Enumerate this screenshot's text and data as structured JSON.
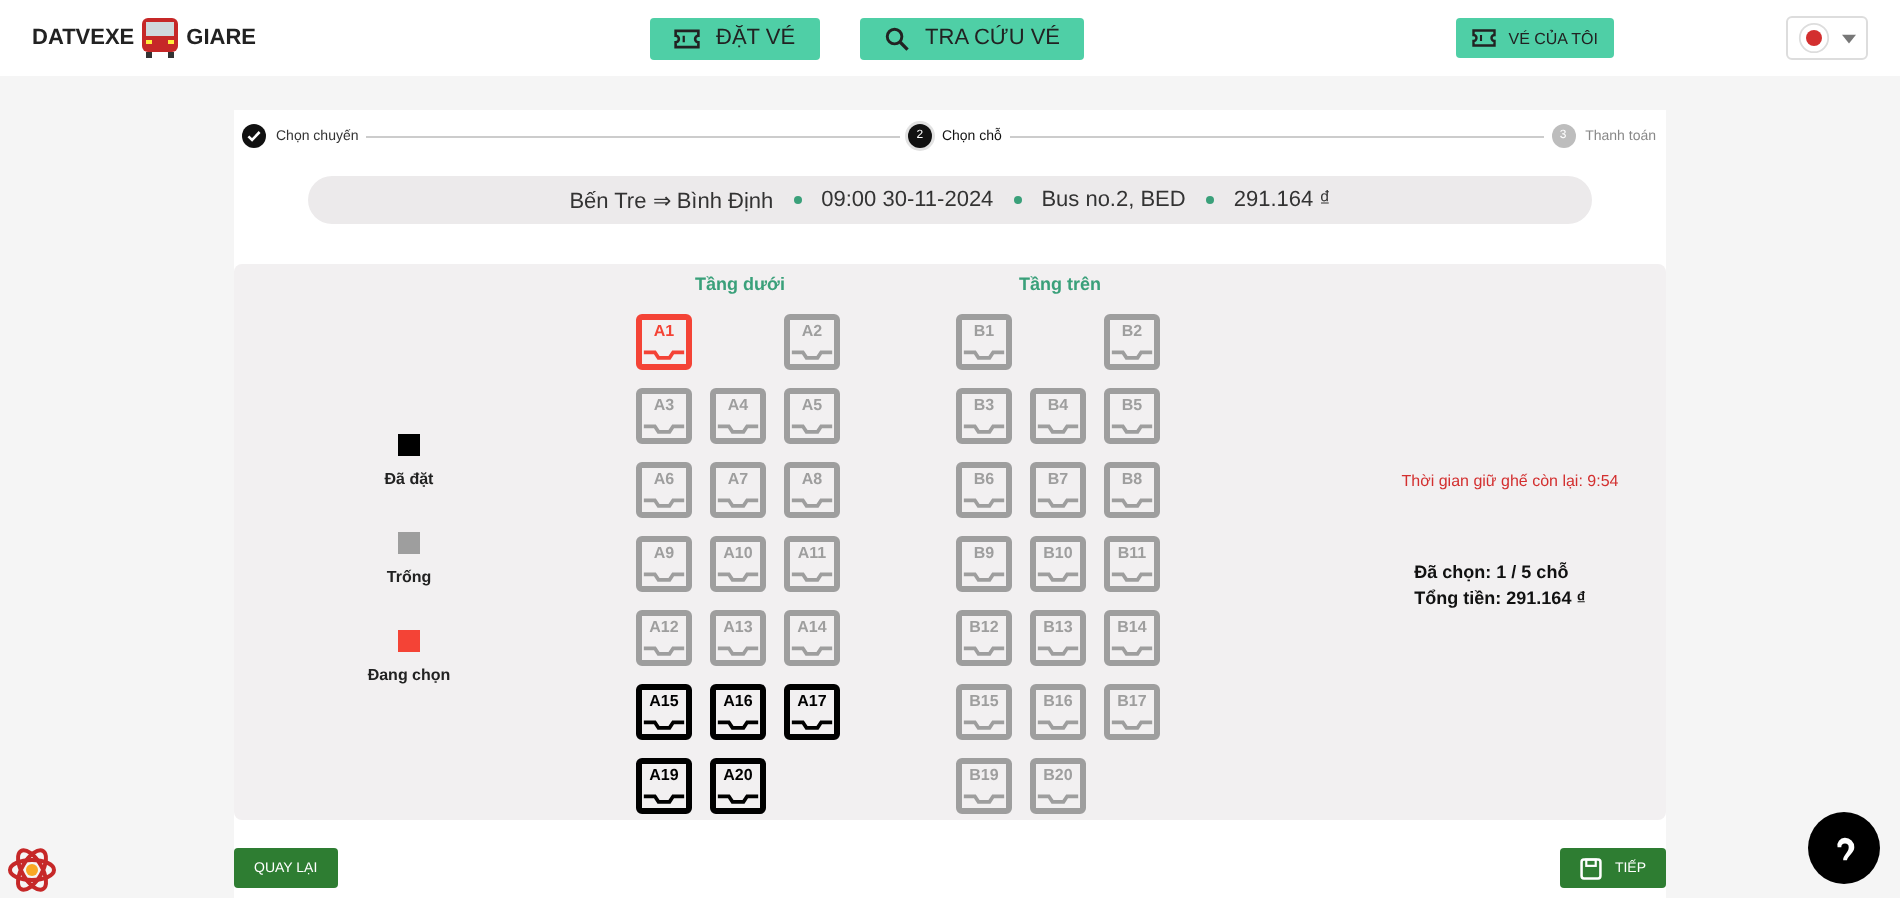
{
  "header": {
    "logo_left": "DATVEXE",
    "logo_right": "GIARE",
    "nav": [
      {
        "label": "ĐẶT VÉ",
        "kind": "ticket"
      },
      {
        "label": "TRA CỨU VÉ",
        "kind": "search"
      }
    ],
    "my_tickets": "VÉ CỦA TÔI"
  },
  "steps": [
    {
      "label": "Chọn chuyến",
      "completed": true,
      "selected": false
    },
    {
      "number": "2",
      "label": "Chọn chỗ",
      "completed": false,
      "selected": true
    },
    {
      "number": "3",
      "label": "Thanh toán",
      "completed": false,
      "selected": false
    }
  ],
  "trip": [
    "Bến Tre ⇒ Bình Định",
    "09:00 30-11-2024",
    "Bus no.2, BED",
    "291.164 ₫"
  ],
  "legend": [
    {
      "label": "Đã đặt",
      "color": "#000000"
    },
    {
      "label": "Trống",
      "color": "#9e9e9e"
    },
    {
      "label": "Đang chọn",
      "color": "#f44336"
    }
  ],
  "decks": [
    {
      "title": "Tầng dưới",
      "rows": [
        [
          {
            "kind": "seat",
            "label": "A1",
            "selected": true,
            "booked": false
          },
          {
            "kind": "empty"
          },
          {
            "kind": "seat",
            "label": "A2",
            "selected": false,
            "booked": false
          }
        ],
        [
          {
            "kind": "seat",
            "label": "A3",
            "selected": false,
            "booked": false
          },
          {
            "kind": "seat",
            "label": "A4",
            "selected": false,
            "booked": false
          },
          {
            "kind": "seat",
            "label": "A5",
            "selected": false,
            "booked": false
          }
        ],
        [
          {
            "kind": "seat",
            "label": "A6",
            "selected": false,
            "booked": false
          },
          {
            "kind": "seat",
            "label": "A7",
            "selected": false,
            "booked": false
          },
          {
            "kind": "seat",
            "label": "A8",
            "selected": false,
            "booked": false
          }
        ],
        [
          {
            "kind": "seat",
            "label": "A9",
            "selected": false,
            "booked": false
          },
          {
            "kind": "seat",
            "label": "A10",
            "selected": false,
            "booked": false
          },
          {
            "kind": "seat",
            "label": "A11",
            "selected": false,
            "booked": false
          }
        ],
        [
          {
            "kind": "seat",
            "label": "A12",
            "selected": false,
            "booked": false
          },
          {
            "kind": "seat",
            "label": "A13",
            "selected": false,
            "booked": false
          },
          {
            "kind": "seat",
            "label": "A14",
            "selected": false,
            "booked": false
          }
        ],
        [
          {
            "kind": "seat",
            "label": "A15",
            "selected": false,
            "booked": true
          },
          {
            "kind": "seat",
            "label": "A16",
            "selected": false,
            "booked": true
          },
          {
            "kind": "seat",
            "label": "A17",
            "selected": false,
            "booked": true
          }
        ],
        [
          {
            "kind": "seat",
            "label": "A19",
            "selected": false,
            "booked": true
          },
          {
            "kind": "seat",
            "label": "A20",
            "selected": false,
            "booked": true
          }
        ]
      ]
    },
    {
      "title": "Tầng trên",
      "rows": [
        [
          {
            "kind": "seat",
            "label": "B1",
            "selected": false,
            "booked": false
          },
          {
            "kind": "empty"
          },
          {
            "kind": "seat",
            "label": "B2",
            "selected": false,
            "booked": false
          }
        ],
        [
          {
            "kind": "seat",
            "label": "B3",
            "selected": false,
            "booked": false
          },
          {
            "kind": "seat",
            "label": "B4",
            "selected": false,
            "booked": false
          },
          {
            "kind": "seat",
            "label": "B5",
            "selected": false,
            "booked": false
          }
        ],
        [
          {
            "kind": "seat",
            "label": "B6",
            "selected": false,
            "booked": false
          },
          {
            "kind": "seat",
            "label": "B7",
            "selected": false,
            "booked": false
          },
          {
            "kind": "seat",
            "label": "B8",
            "selected": false,
            "booked": false
          }
        ],
        [
          {
            "kind": "seat",
            "label": "B9",
            "selected": false,
            "booked": false
          },
          {
            "kind": "seat",
            "label": "B10",
            "selected": false,
            "booked": false
          },
          {
            "kind": "seat",
            "label": "B11",
            "selected": false,
            "booked": false
          }
        ],
        [
          {
            "kind": "seat",
            "label": "B12",
            "selected": false,
            "booked": false
          },
          {
            "kind": "seat",
            "label": "B13",
            "selected": false,
            "booked": false
          },
          {
            "kind": "seat",
            "label": "B14",
            "selected": false,
            "booked": false
          }
        ],
        [
          {
            "kind": "seat",
            "label": "B15",
            "selected": false,
            "booked": false
          },
          {
            "kind": "seat",
            "label": "B16",
            "selected": false,
            "booked": false
          },
          {
            "kind": "seat",
            "label": "B17",
            "selected": false,
            "booked": false
          }
        ],
        [
          {
            "kind": "seat",
            "label": "B19",
            "selected": false,
            "booked": false
          },
          {
            "kind": "seat",
            "label": "B20",
            "selected": false,
            "booked": false
          }
        ]
      ]
    }
  ],
  "timer": "Thời gian giữ ghế còn lại: 9:54",
  "selected_count": "Đã chọn: 1 / 5 chỗ",
  "total": "Tổng tiền: 291.164 ₫",
  "back_button": "QUAY LẠI",
  "next_button": "TIẾP"
}
